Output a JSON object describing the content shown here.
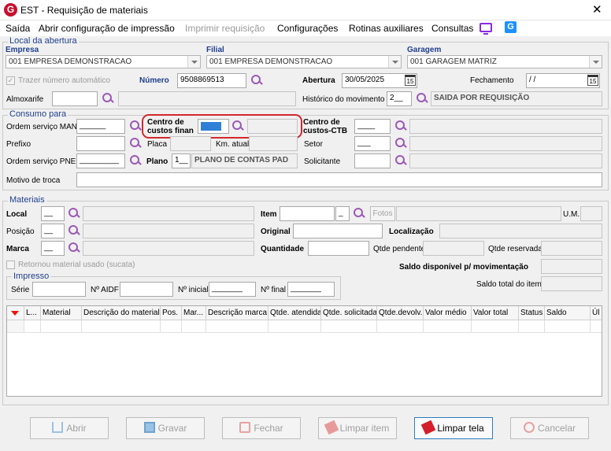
{
  "window": {
    "title": "EST - Requisição de materiais",
    "logo_letter": "G",
    "close_glyph": "✕"
  },
  "menu": {
    "items": [
      {
        "label": "Saída",
        "enabled": true
      },
      {
        "label": "Abrir configuração de impressão",
        "enabled": true
      },
      {
        "label": "Imprimir requisição",
        "enabled": false
      },
      {
        "label": "Configurações",
        "enabled": true
      },
      {
        "label": "Rotinas auxiliares",
        "enabled": true
      },
      {
        "label": "Consultas",
        "enabled": true
      }
    ],
    "icons": [
      "monitor-icon",
      "g-badge-icon"
    ],
    "g_badge_letter": "G"
  },
  "abertura": {
    "section": "Local da abertura",
    "empresa_label": "Empresa",
    "empresa_value": "001 EMPRESA DEMONSTRACAO",
    "filial_label": "Filial",
    "filial_value": "001 EMPRESA DEMONSTRACAO",
    "garagem_label": "Garagem",
    "garagem_value": "001 GARAGEM MATRIZ",
    "trazer_label": "Trazer número automático",
    "trazer_checked": true,
    "numero_label": "Número",
    "numero_value": "9508869513",
    "abertura_label": "Abertura",
    "abertura_value": "30/05/2025",
    "fechamento_label": "Fechamento",
    "fechamento_value": "/ /",
    "cal_glyph": "15",
    "almoxarife_label": "Almoxarife",
    "almoxarife_value": "",
    "historico_label": "Histórico do movimento",
    "historico_code": "2__",
    "historico_desc": "SAIDA POR REQUISIÇÃO"
  },
  "consumo": {
    "section": "Consumo para",
    "os_man_label": "Ordem serviço MAN",
    "os_man_value": "______",
    "centro_fin_label": "Centro de custos finan",
    "centro_fin_value": "",
    "centro_ctb_label": "Centro de custos-CTB",
    "centro_ctb_value": "____",
    "prefixo_label": "Prefixo",
    "placa_label": "Placa",
    "km_label": "Km. atual",
    "setor_label": "Setor",
    "setor_value": "___",
    "os_pne_label": "Ordem serviço PNE",
    "os_pne_value": "_________",
    "plano_label": "Plano",
    "plano_code": "1__",
    "plano_desc": "PLANO DE CONTAS PAD",
    "solicitante_label": "Solicitante",
    "motivo_label": "Motivo de troca"
  },
  "materiais": {
    "section": "Materiais",
    "local_label": "Local",
    "local_value": "__",
    "item_label": "Item",
    "item_sub": "_",
    "fotos_label": "Fotos",
    "um_label": "U.M.",
    "posicao_label": "Posição",
    "posicao_value": "__",
    "original_label": "Original",
    "localizacao_label": "Localização",
    "marca_label": "Marca",
    "marca_value": "__",
    "quantidade_label": "Quantidade",
    "qtde_pendente_label": "Qtde pendente",
    "qtde_reservada_label": "Qtde reservada",
    "retornou_label": "Retornou material usado (sucata)",
    "saldo_mov_label": "Saldo disponível p/ movimentação",
    "saldo_total_label": "Saldo total do item"
  },
  "impresso": {
    "section": "Impresso",
    "serie_label": "Série",
    "aidf_label": "Nº AIDF",
    "inicial_label": "Nº inicial",
    "inicial_value": "_______",
    "final_label": "Nº final",
    "final_value": "_______"
  },
  "grid": {
    "columns": [
      "",
      "L...",
      "Material",
      "Descrição do material",
      "Pos.",
      "Mar...",
      "Descrição marca",
      "Qtde. atendida",
      "Qtde. solicitada",
      "Qtde.devolv.",
      "Valor médio",
      "Valor total",
      "Status",
      "Saldo",
      "Úl"
    ]
  },
  "buttons": [
    {
      "label": "Abrir",
      "enabled": false,
      "icon": "open-icon"
    },
    {
      "label": "Gravar",
      "enabled": false,
      "icon": "save-icon"
    },
    {
      "label": "Fechar",
      "enabled": false,
      "icon": "lock-icon"
    },
    {
      "label": "Limpar item",
      "enabled": false,
      "icon": "eraser-icon"
    },
    {
      "label": "Limpar tela",
      "enabled": true,
      "icon": "eraser-icon"
    },
    {
      "label": "Cancelar",
      "enabled": false,
      "icon": "cancel-icon"
    }
  ],
  "colors": {
    "section": "#1f3e8c",
    "highlight": "#d4282d",
    "accent": "#2e7dbd",
    "search": "#9b59b6"
  }
}
